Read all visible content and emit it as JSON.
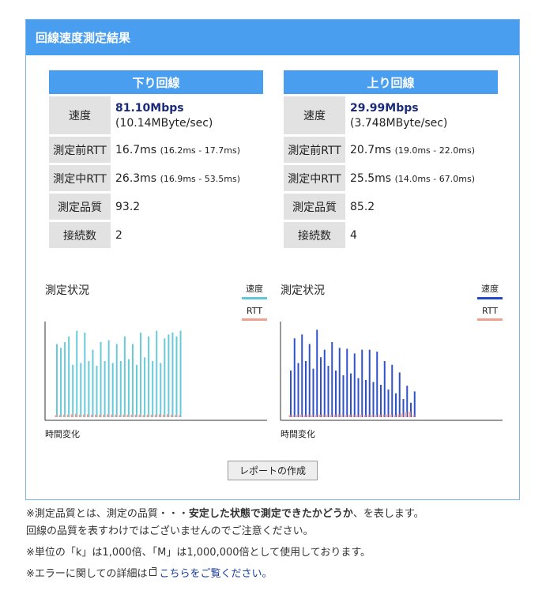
{
  "panel": {
    "title": "回線速度測定結果"
  },
  "download": {
    "title": "下り回線",
    "speed_label": "速度",
    "speed_main": "81.10Mbps",
    "speed_sub": "(10.14MByte/sec)",
    "rtt_before_label": "測定前RTT",
    "rtt_before_value": "16.7ms",
    "rtt_before_range": "(16.2ms - 17.7ms)",
    "rtt_during_label": "測定中RTT",
    "rtt_during_value": "26.3ms",
    "rtt_during_range": "(16.9ms - 53.5ms)",
    "quality_label": "測定品質",
    "quality_value": "93.2",
    "connections_label": "接続数",
    "connections_value": "2"
  },
  "upload": {
    "title": "上り回線",
    "speed_label": "速度",
    "speed_main": "29.99Mbps",
    "speed_sub": "(3.748MByte/sec)",
    "rtt_before_label": "測定前RTT",
    "rtt_before_value": "20.7ms",
    "rtt_before_range": "(19.0ms - 22.0ms)",
    "rtt_during_label": "測定中RTT",
    "rtt_during_value": "25.5ms",
    "rtt_during_range": "(14.0ms - 67.0ms)",
    "quality_label": "測定品質",
    "quality_value": "85.2",
    "connections_label": "接続数",
    "connections_value": "4"
  },
  "graphs": {
    "title": "測定状況",
    "legend_speed": "速度",
    "legend_rtt": "RTT",
    "x_label": "時間変化",
    "down_speed_color": "#5fc8d8",
    "up_speed_color": "#2448c8",
    "rtt_color": "#f0a090"
  },
  "chart_data": [
    {
      "type": "bar",
      "series": [
        {
          "name": "速度",
          "values": [
            0.78,
            0.74,
            0.8,
            0.86,
            0.56,
            0.92,
            0.58,
            0.9,
            0.6,
            0.72,
            0.55,
            0.8,
            0.6,
            0.82,
            0.58,
            0.78,
            0.6,
            0.86,
            0.62,
            0.78,
            0.56,
            0.9,
            0.64,
            0.86,
            0.6,
            0.92,
            0.58,
            0.84,
            0.88,
            0.9,
            0.86,
            0.92
          ]
        },
        {
          "name": "RTT",
          "values": [
            0.05,
            0.05,
            0.06,
            0.06,
            0.07,
            0.08,
            0.06,
            0.06,
            0.07,
            0.06,
            0.06,
            0.06,
            0.06,
            0.07,
            0.06,
            0.06,
            0.05,
            0.06,
            0.06,
            0.06,
            0.06,
            0.06,
            0.05,
            0.06,
            0.06,
            0.06,
            0.07,
            0.06,
            0.07,
            0.06,
            0.05,
            0.05
          ]
        }
      ]
    },
    {
      "type": "bar",
      "series": [
        {
          "name": "速度",
          "values": [
            0.5,
            0.84,
            0.58,
            0.88,
            0.6,
            0.78,
            0.52,
            0.93,
            0.64,
            0.72,
            0.55,
            0.8,
            0.5,
            0.74,
            0.45,
            0.73,
            0.47,
            0.68,
            0.42,
            0.72,
            0.4,
            0.72,
            0.38,
            0.7,
            0.35,
            0.6,
            0.3,
            0.56,
            0.26,
            0.48,
            0.2,
            0.34,
            0.16,
            0.28
          ]
        },
        {
          "name": "RTT",
          "values": [
            0.05,
            0.05,
            0.05,
            0.06,
            0.05,
            0.06,
            0.05,
            0.05,
            0.06,
            0.06,
            0.05,
            0.05,
            0.06,
            0.07,
            0.05,
            0.05,
            0.06,
            0.05,
            0.05,
            0.06,
            0.05,
            0.06,
            0.05,
            0.05,
            0.06,
            0.06,
            0.07,
            0.06,
            0.05,
            0.07,
            0.09,
            0.12,
            0.13,
            0.05
          ]
        }
      ]
    }
  ],
  "report_button": "レポートの作成",
  "notes": {
    "n1_a": "※測定品質とは、測定の品質・・・",
    "n1_b": "安定した状態で測定できたかどうか",
    "n1_c": "、を表します。",
    "n2": "回線の品質を表すわけではございませんのでご注意ください。",
    "n3": "※単位の「k」は1,000倍、「M」は1,000,000倍として使用しております。",
    "n4_a": "※エラーに関しての詳細は",
    "n4_link": "こちらをご覧ください。"
  }
}
